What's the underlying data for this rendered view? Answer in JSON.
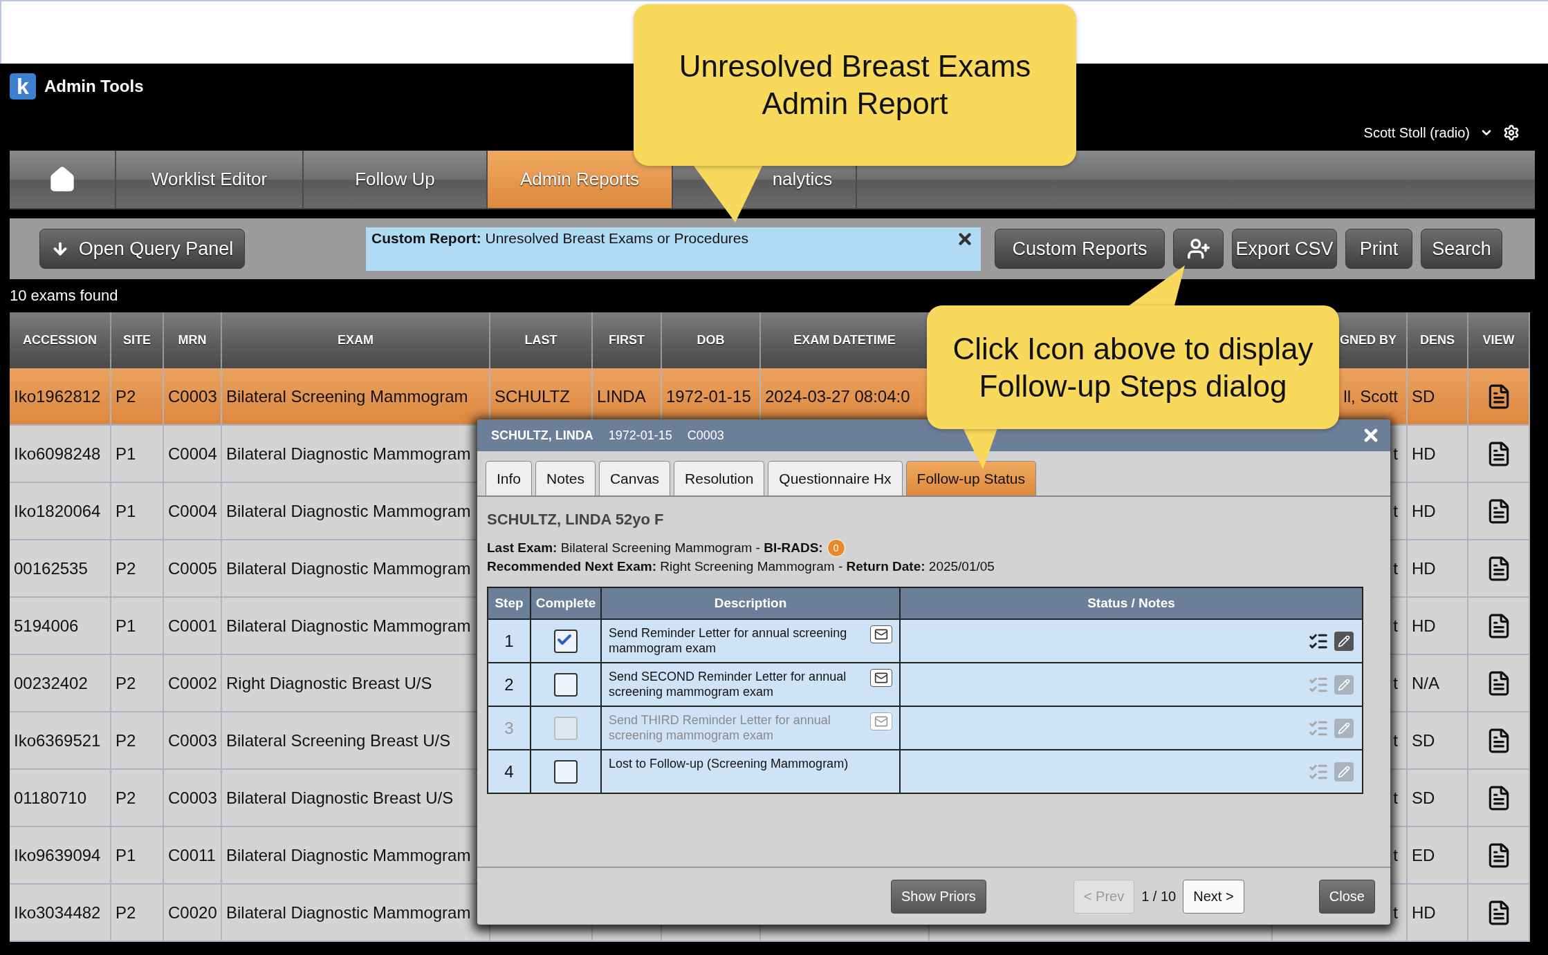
{
  "app": {
    "logo": "k",
    "title": "Admin Tools",
    "user": "Scott Stoll (radio)"
  },
  "nav": [
    {
      "kind": "home",
      "selected": false
    },
    {
      "kind": "text",
      "label": "Worklist Editor",
      "selected": false
    },
    {
      "kind": "text",
      "label": "Follow Up",
      "selected": false
    },
    {
      "kind": "text",
      "label": "Admin Reports",
      "selected": true
    },
    {
      "kind": "text",
      "label": "nalytics",
      "selected": false
    }
  ],
  "toolbar": {
    "open_query": "Open Query Panel",
    "report": "**Custom Report:** Unresolved Breast Exams or Procedures",
    "buttons": [
      {
        "kind": "text",
        "label": "Custom Reports"
      },
      {
        "kind": "add-user"
      },
      {
        "kind": "text",
        "label": "Export CSV"
      },
      {
        "kind": "text",
        "label": "Print"
      },
      {
        "kind": "text",
        "label": "Search"
      }
    ]
  },
  "count": "10 exams found",
  "table": {
    "columns": [
      "ACCESSION",
      "SITE",
      "MRN",
      "EXAM",
      "LAST",
      "FIRST",
      "DOB",
      "EXAM DATETIME",
      "GNED BY",
      "DENS",
      "VIEW"
    ],
    "rows": [
      {
        "selected": true,
        "accession": "Iko1962812",
        "site": "P2",
        "mrn": "C0003",
        "exam": "Bilateral Screening Mammogram",
        "last": "SCHULTZ",
        "first": "LINDA",
        "dob": "1972-01-15",
        "exam_datetime": "2024-03-27 08:04:0",
        "assigned_by": "ll, Scott",
        "dens": "SD"
      },
      {
        "selected": false,
        "accession": "Iko6098248",
        "site": "P1",
        "mrn": "C0004",
        "exam": "Bilateral Diagnostic Mammogram",
        "assigned_by": "t",
        "dens": "HD"
      },
      {
        "selected": false,
        "accession": "Iko1820064",
        "site": "P1",
        "mrn": "C0004",
        "exam": "Bilateral Diagnostic Mammogram",
        "assigned_by": "t",
        "dens": "HD"
      },
      {
        "selected": false,
        "accession": "00162535",
        "site": "P2",
        "mrn": "C0005",
        "exam": "Bilateral Diagnostic Mammogram",
        "assigned_by": "t",
        "dens": "HD"
      },
      {
        "selected": false,
        "accession": "5194006",
        "site": "P1",
        "mrn": "C0001",
        "exam": "Bilateral Diagnostic Mammogram",
        "assigned_by": "t",
        "dens": "HD"
      },
      {
        "selected": false,
        "accession": "00232402",
        "site": "P2",
        "mrn": "C0002",
        "exam": "Right Diagnostic Breast U/S",
        "assigned_by": "t",
        "dens": "N/A"
      },
      {
        "selected": false,
        "accession": "Iko6369521",
        "site": "P2",
        "mrn": "C0003",
        "exam": "Bilateral Screening Breast U/S",
        "assigned_by": "t",
        "dens": "SD"
      },
      {
        "selected": false,
        "accession": "01180710",
        "site": "P2",
        "mrn": "C0003",
        "exam": "Bilateral Diagnostic Breast U/S",
        "assigned_by": "t",
        "dens": "SD"
      },
      {
        "selected": false,
        "accession": "Iko9639094",
        "site": "P1",
        "mrn": "C0011",
        "exam": "Bilateral Diagnostic Mammogram",
        "assigned_by": "t",
        "dens": "ED"
      },
      {
        "selected": false,
        "accession": "Iko3034482",
        "site": "P2",
        "mrn": "C0020",
        "exam": "Bilateral Diagnostic Mammogram",
        "assigned_by": "t",
        "dens": "HD"
      }
    ]
  },
  "dialog": {
    "title": {
      "name": "SCHULTZ, LINDA",
      "dob": "1972-01-15",
      "mrn": "C0003"
    },
    "tabs": [
      {
        "label": "Info",
        "selected": false
      },
      {
        "label": "Notes",
        "selected": false
      },
      {
        "label": "Canvas",
        "selected": false
      },
      {
        "label": "Resolution",
        "selected": false
      },
      {
        "label": "Questionnaire Hx",
        "selected": false
      },
      {
        "label": "Follow-up Status",
        "selected": true
      }
    ],
    "patient": "SCHULTZ, LINDA 52yo F",
    "last_exam": "**Last Exam:** Bilateral Screening Mammogram - **BI-RADS:**",
    "birads": "0",
    "next_exam": "**Recommended Next Exam:** Right Screening Mammogram - **Return Date:** 2025/01/05",
    "steps": {
      "columns": [
        "Step",
        "Complete",
        "Description",
        "Status / Notes"
      ],
      "rows": [
        {
          "step": "1",
          "checked": true,
          "disabled": false,
          "letter": true,
          "actions_enabled": true,
          "description": "Send Reminder Letter for annual screening mammogram exam"
        },
        {
          "step": "2",
          "checked": false,
          "disabled": false,
          "letter": true,
          "actions_enabled": false,
          "description": "Send SECOND Reminder Letter for annual screening mammogram exam"
        },
        {
          "step": "3",
          "checked": false,
          "disabled": true,
          "letter": true,
          "actions_enabled": false,
          "description": "Send THIRD Reminder Letter for annual screening mammogram exam"
        },
        {
          "step": "4",
          "checked": false,
          "disabled": false,
          "letter": false,
          "actions_enabled": false,
          "description": "Lost to Follow-up (Screening Mammogram)"
        }
      ]
    },
    "footer": {
      "show_priors": "Show Priors",
      "prev": {
        "label": "< Prev",
        "disabled": true
      },
      "page": "1 / 10",
      "next": {
        "label": "Next >",
        "disabled": false
      },
      "close": "Close"
    }
  },
  "callouts": [
    {
      "lines": [
        "Unresolved Breast Exams",
        "Admin Report"
      ]
    },
    {
      "lines": [
        "Click Icon above to display",
        "Follow-up Steps dialog"
      ]
    }
  ]
}
